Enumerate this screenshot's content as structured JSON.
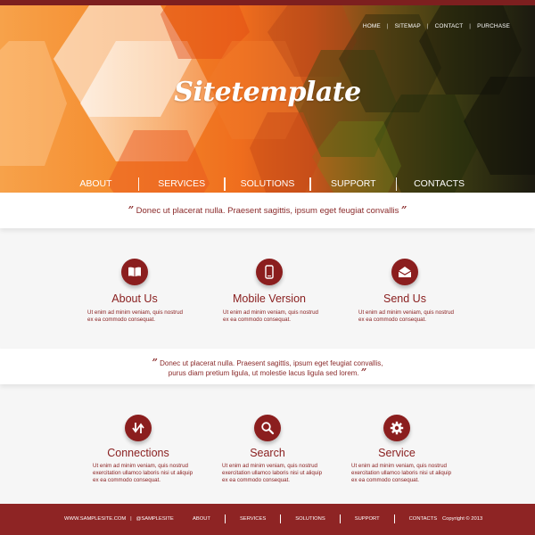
{
  "header": {
    "logo": "Sitetemplate",
    "top_menu": [
      "HOME",
      "SITEMAP",
      "CONTACT",
      "PURCHASE"
    ],
    "top_menu_separator": "|",
    "main_nav": [
      "ABOUT",
      "SERVICES",
      "SOLUTIONS",
      "SUPPORT",
      "CONTACTS"
    ]
  },
  "quote1": {
    "open": "”",
    "text": "Donec ut placerat nulla. Praesent sagittis, ipsum eget feugiat convallis",
    "close": "”"
  },
  "features_top": [
    {
      "icon": "book-icon",
      "title": "About Us",
      "desc_lines": [
        "Ut enim ad minim veniam, quis nostrud",
        "ex ea commodo consequat."
      ]
    },
    {
      "icon": "mobile-icon",
      "title": "Mobile Version",
      "desc_lines": [
        "Ut enim ad minim veniam, quis nostrud",
        "ex ea commodo consequat."
      ]
    },
    {
      "icon": "envelope-icon",
      "title": "Send Us",
      "desc_lines": [
        "Ut enim ad minim veniam, quis nostrud",
        "ex ea commodo consequat."
      ]
    }
  ],
  "quote2": {
    "open": "”",
    "line1": "Donec ut placerat nulla. Praesent sagittis, ipsum eget feugiat convallis,",
    "line2": "purus diam pretium ligula, ut molestie lacus ligula sed lorem.",
    "close": "”"
  },
  "features_bottom": [
    {
      "icon": "transfer-arrows-icon",
      "title": "Connections",
      "desc_lines": [
        "Ut enim ad minim veniam, quis nostrud",
        "exercitation ullamco laboris nisi ut aliquip",
        "ex ea commodo consequat."
      ]
    },
    {
      "icon": "search-icon",
      "title": "Search",
      "desc_lines": [
        "Ut enim ad minim veniam, quis nostrud",
        "exercitation ullamco laboris nisi ut aliquip",
        "ex ea commodo consequat."
      ]
    },
    {
      "icon": "gear-icon",
      "title": "Service",
      "desc_lines": [
        "Ut enim ad minim veniam, quis nostrud",
        "exercitation ullamco laboris nisi ut aliquip",
        "ex ea commodo consequat."
      ]
    }
  ],
  "footer": {
    "site": "WWW.SAMPLESITE.COM",
    "separator": "|",
    "handle": "@SAMPLESITE",
    "nav": [
      "ABOUT",
      "SERVICES",
      "SOLUTIONS",
      "SUPPORT",
      "CONTACTS"
    ],
    "copyright": "Copyright © 2013"
  },
  "colors": {
    "brand": "#8e2424",
    "accent_text": "#8a2020",
    "top_bar": "#7d1f1f"
  }
}
